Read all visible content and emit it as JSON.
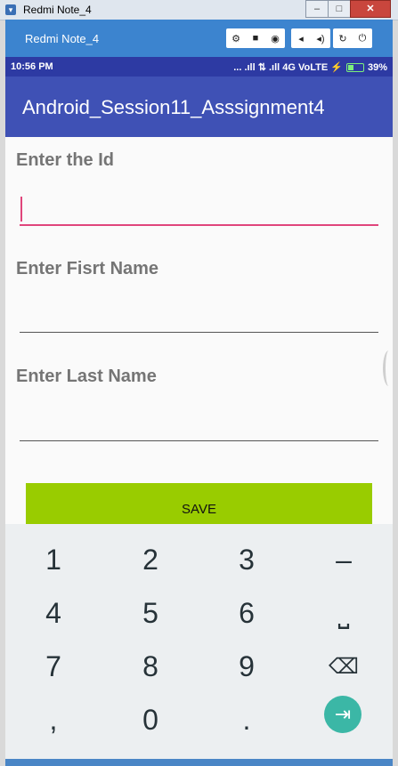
{
  "window": {
    "title": "Redmi Note_4",
    "minimize": "–",
    "maximize": "□",
    "close": "✕"
  },
  "device_bar": {
    "name": "Redmi Note_4",
    "tools": [
      "⚙",
      "■",
      "◉",
      "◂",
      "◂)",
      "↻",
      "⏻"
    ]
  },
  "status": {
    "time": "10:56 PM",
    "indicators": "... .ıll ⇅ .ıll 4G VoLTE ⚡",
    "battery": "39%"
  },
  "app": {
    "title": "Android_Session11_Asssignment4"
  },
  "form": {
    "id_label": "Enter the Id",
    "first_label": "Enter Fisrt Name",
    "last_label": "Enter Last Name",
    "save_label": "SAVE"
  },
  "keypad": {
    "keys": [
      "1",
      "2",
      "3",
      "–",
      "4",
      "5",
      "6",
      "⎵",
      "7",
      "8",
      "9",
      "⌫",
      ",",
      "0",
      ".",
      "⇥"
    ]
  }
}
